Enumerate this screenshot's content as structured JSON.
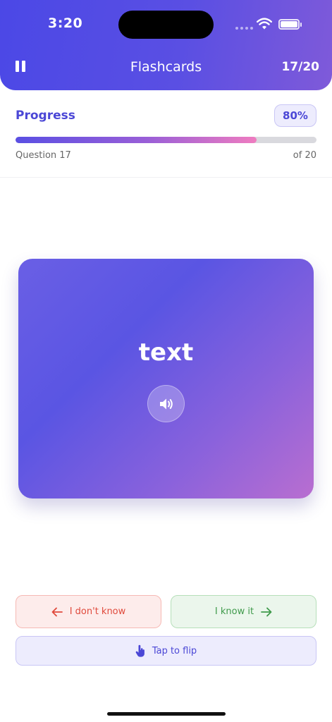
{
  "status_bar": {
    "time": "3:20"
  },
  "header": {
    "title": "Flashcards",
    "count": "17/20"
  },
  "progress": {
    "label": "Progress",
    "percent_label": "80%",
    "fraction": 0.8,
    "question_label": "Question 17",
    "total_label": "of 20"
  },
  "card": {
    "word": "text"
  },
  "actions": {
    "dont_know": "I don't know",
    "know_it": "I know it",
    "tap_to_flip": "Tap to flip"
  },
  "colors": {
    "accent": "#4b47d6",
    "danger": "#e04a3c",
    "success": "#3f9a4b"
  }
}
